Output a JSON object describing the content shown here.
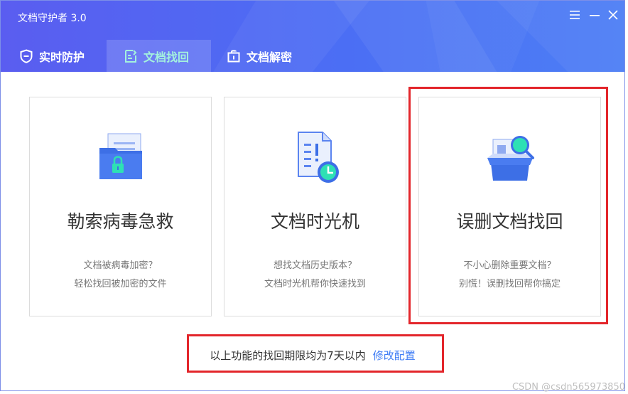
{
  "window": {
    "title": "文档守护者 3.0"
  },
  "tabs": [
    {
      "label": "实时防护",
      "icon": "shield-icon",
      "active": false
    },
    {
      "label": "文档找回",
      "icon": "document-recovery-icon",
      "active": true
    },
    {
      "label": "文档解密",
      "icon": "unlock-icon",
      "active": false
    }
  ],
  "cards": [
    {
      "title": "勒索病毒急救",
      "line1": "文档被病毒加密？",
      "line2": "轻松找回被加密的文件",
      "icon": "locked-folder-icon"
    },
    {
      "title": "文档时光机",
      "line1": "想找文档历史版本？",
      "line2": "文档时光机帮你快速找到",
      "icon": "document-clock-icon"
    },
    {
      "title": "误删文档找回",
      "line1": "不小心删除重要文档？",
      "line2": "别慌！误删找回帮你搞定",
      "icon": "box-search-icon"
    }
  ],
  "notice": {
    "text": "以上功能的找回期限均为7天以内",
    "link": "修改配置"
  },
  "watermark": "CSDN @csdn565973850",
  "colors": {
    "header_start": "#5a5df0",
    "header_end": "#4c7ef5",
    "active_tab_text": "#a4f2dd",
    "link": "#3e7cf5",
    "highlight": "#e3262b"
  }
}
